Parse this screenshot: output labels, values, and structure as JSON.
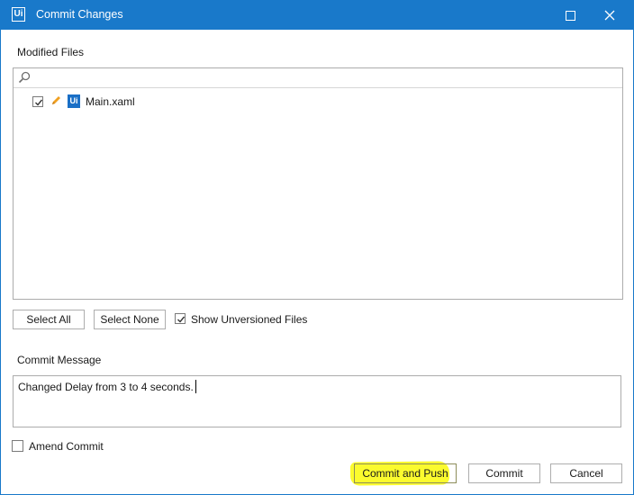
{
  "window": {
    "title": "Commit Changes",
    "logo_text": "Ui",
    "accent_color": "#1979ca"
  },
  "modified_files": {
    "label": "Modified Files",
    "search_placeholder": "",
    "files": [
      {
        "name": "Main.xaml",
        "checked": true,
        "status_icon": "pencil-icon",
        "type_icon": "ui-file-icon",
        "type_icon_text": "Ui"
      }
    ]
  },
  "selection": {
    "select_all_label": "Select All",
    "select_none_label": "Select None",
    "show_unversioned_label": "Show Unversioned Files",
    "show_unversioned_checked": true
  },
  "commit_message": {
    "label": "Commit Message",
    "value": "Changed Delay from 3 to 4 seconds."
  },
  "amend": {
    "label": "Amend Commit",
    "checked": false
  },
  "actions": {
    "commit_and_push_label": "Commit and Push",
    "commit_label": "Commit",
    "cancel_label": "Cancel",
    "highlight_color": "#fbfb2e"
  }
}
